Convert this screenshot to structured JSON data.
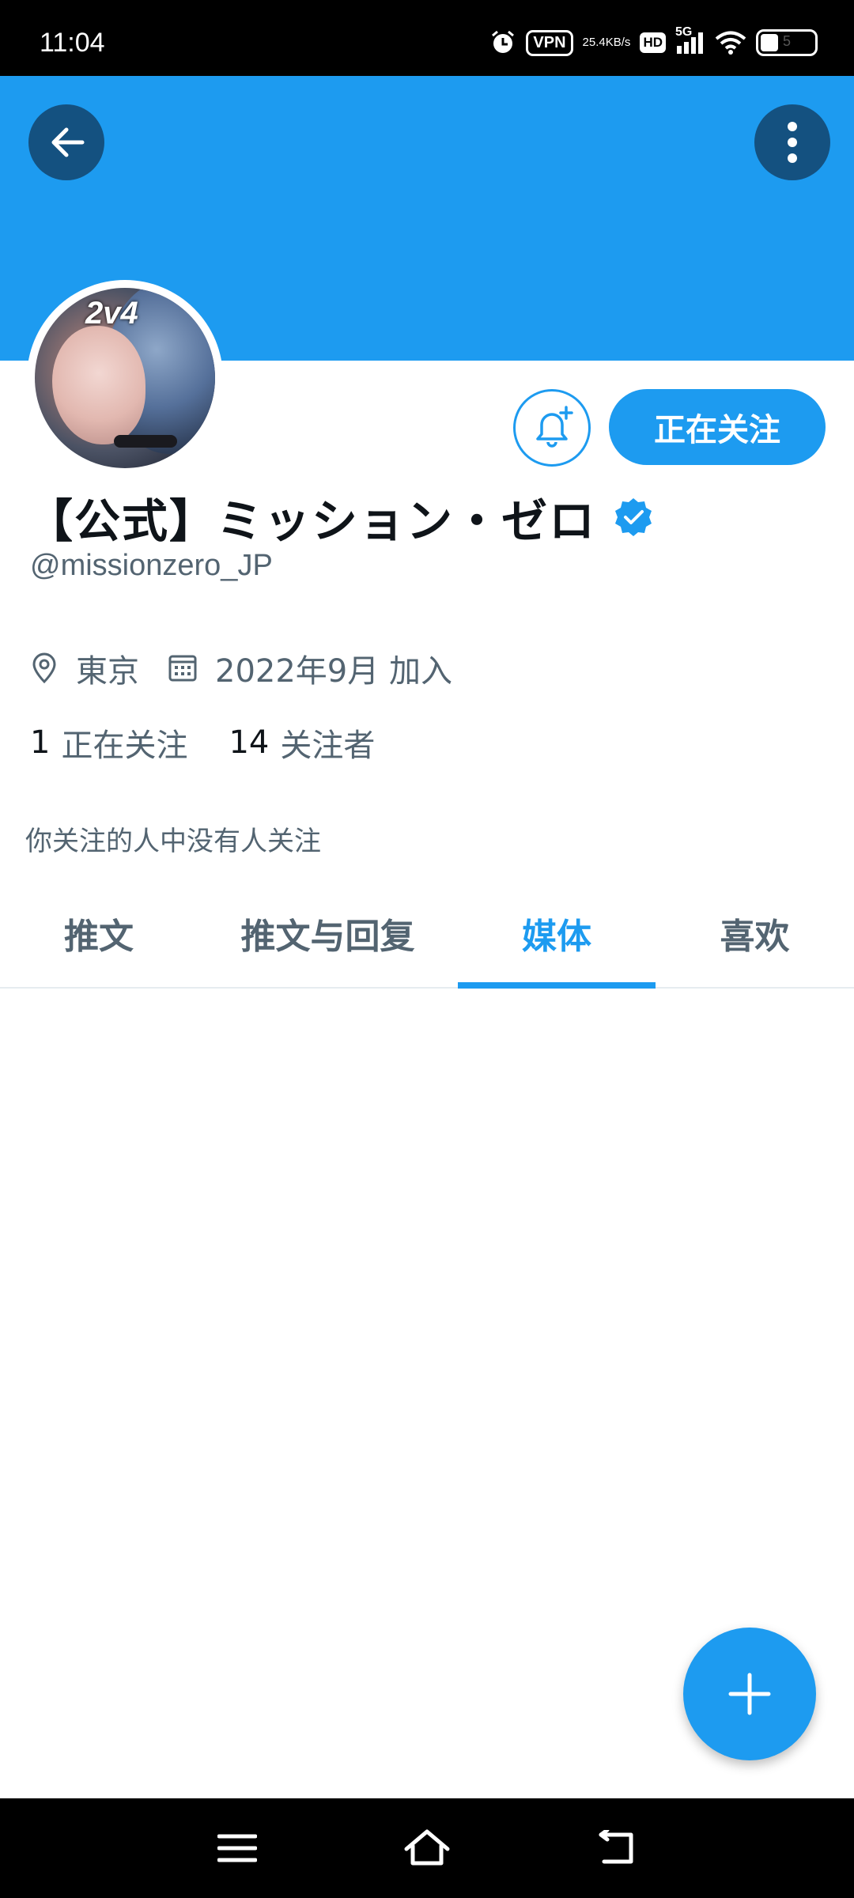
{
  "status_bar": {
    "time": "11:04",
    "vpn": "VPN",
    "speed_value": "25.4",
    "speed_unit": "KB/s",
    "hd": "HD",
    "network": "5G",
    "battery_level": "5",
    "icons": [
      "alarm-icon",
      "vpn-icon",
      "hd-icon",
      "signal-icon",
      "wifi-icon",
      "battery-icon"
    ]
  },
  "header": {
    "banner_color": "#1d9bf0",
    "back_icon": "arrow-left-icon",
    "more_icon": "more-vertical-icon"
  },
  "profile": {
    "avatar_text": "2v4",
    "display_name": "【公式】ミッション・ゼロ",
    "verified": true,
    "handle": "@missionzero_JP",
    "location": "東京",
    "joined": "2022年9月 加入",
    "following_count": "1",
    "following_label": "正在关注",
    "followers_count": "14",
    "followers_label": "关注者",
    "followers_you_know": "你关注的人中没有人关注"
  },
  "actions": {
    "notify_icon": "bell-plus-icon",
    "follow_label": "正在关注"
  },
  "tabs": [
    {
      "label": "推文",
      "active": false
    },
    {
      "label": "推文与回复",
      "active": false
    },
    {
      "label": "媒体",
      "active": true
    },
    {
      "label": "喜欢",
      "active": false
    }
  ],
  "fab": {
    "icon": "plus-icon"
  },
  "nav_bar": {
    "icons": [
      "menu-icon",
      "home-icon",
      "back-icon"
    ]
  },
  "colors": {
    "accent": "#1d9bf0",
    "text_primary": "#0f1419",
    "text_secondary": "#536471"
  }
}
